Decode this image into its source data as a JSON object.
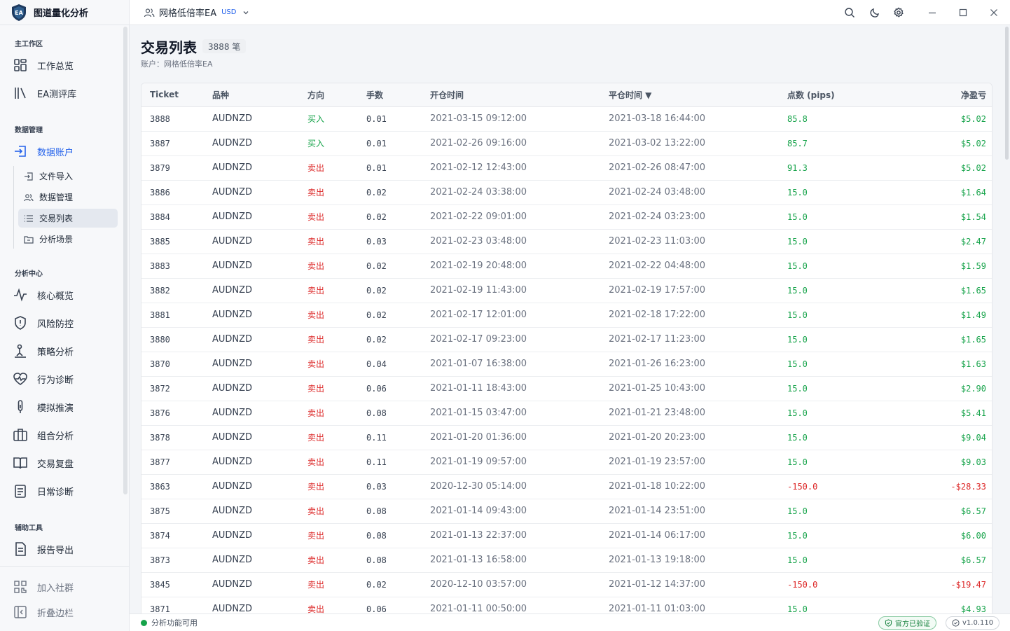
{
  "app": {
    "title": "图道量化分析",
    "logo_text": "EA"
  },
  "topbar": {
    "account_name": "网格低倍率EA",
    "currency": "USD"
  },
  "sidebar": {
    "sections": {
      "main": "主工作区",
      "data": "数据管理",
      "analysis": "分析中心",
      "tools": "辅助工具"
    },
    "main_items": [
      {
        "label": "工作总览"
      },
      {
        "label": "EA测评库"
      }
    ],
    "data_account": {
      "label": "数据账户"
    },
    "data_sub_items": [
      {
        "label": "文件导入"
      },
      {
        "label": "数据管理"
      },
      {
        "label": "交易列表"
      },
      {
        "label": "分析场景"
      }
    ],
    "analysis_items": [
      {
        "label": "核心概览"
      },
      {
        "label": "风险防控"
      },
      {
        "label": "策略分析"
      },
      {
        "label": "行为诊断"
      },
      {
        "label": "模拟推演"
      },
      {
        "label": "组合分析"
      },
      {
        "label": "交易复盘"
      },
      {
        "label": "日常诊断"
      }
    ],
    "tool_items": [
      {
        "label": "报告导出"
      }
    ],
    "bottom_items": [
      {
        "label": "加入社群"
      },
      {
        "label": "折叠边栏"
      }
    ]
  },
  "page": {
    "title": "交易列表",
    "count": "3888 笔",
    "subtitle": "账户：网格低倍率EA"
  },
  "table": {
    "columns": [
      "Ticket",
      "品种",
      "方向",
      "手数",
      "开仓时间",
      "平仓时间 ▼",
      "点数 (pips)",
      "净盈亏"
    ],
    "rows": [
      [
        "3888",
        "AUDNZD",
        "买入",
        "0.01",
        "2021-03-15 09:12:00",
        "2021-03-18 16:44:00",
        "85.8",
        "$5.02"
      ],
      [
        "3887",
        "AUDNZD",
        "买入",
        "0.01",
        "2021-02-26 09:16:00",
        "2021-03-02 13:22:00",
        "85.7",
        "$5.02"
      ],
      [
        "3879",
        "AUDNZD",
        "卖出",
        "0.01",
        "2021-02-12 12:43:00",
        "2021-02-26 08:47:00",
        "91.3",
        "$5.02"
      ],
      [
        "3886",
        "AUDNZD",
        "卖出",
        "0.02",
        "2021-02-24 03:38:00",
        "2021-02-24 03:48:00",
        "15.0",
        "$1.64"
      ],
      [
        "3884",
        "AUDNZD",
        "卖出",
        "0.02",
        "2021-02-22 09:01:00",
        "2021-02-24 03:23:00",
        "15.0",
        "$1.54"
      ],
      [
        "3885",
        "AUDNZD",
        "卖出",
        "0.03",
        "2021-02-23 03:48:00",
        "2021-02-23 11:03:00",
        "15.0",
        "$2.47"
      ],
      [
        "3883",
        "AUDNZD",
        "卖出",
        "0.02",
        "2021-02-19 20:48:00",
        "2021-02-22 04:48:00",
        "15.0",
        "$1.59"
      ],
      [
        "3882",
        "AUDNZD",
        "卖出",
        "0.02",
        "2021-02-19 11:43:00",
        "2021-02-19 17:57:00",
        "15.0",
        "$1.65"
      ],
      [
        "3881",
        "AUDNZD",
        "卖出",
        "0.02",
        "2021-02-17 12:01:00",
        "2021-02-18 17:22:00",
        "15.0",
        "$1.49"
      ],
      [
        "3880",
        "AUDNZD",
        "卖出",
        "0.02",
        "2021-02-17 09:23:00",
        "2021-02-17 11:23:00",
        "15.0",
        "$1.65"
      ],
      [
        "3870",
        "AUDNZD",
        "卖出",
        "0.04",
        "2021-01-07 16:38:00",
        "2021-01-26 16:23:00",
        "15.0",
        "$1.63"
      ],
      [
        "3872",
        "AUDNZD",
        "卖出",
        "0.06",
        "2021-01-11 18:43:00",
        "2021-01-25 10:43:00",
        "15.0",
        "$2.90"
      ],
      [
        "3876",
        "AUDNZD",
        "卖出",
        "0.08",
        "2021-01-15 03:47:00",
        "2021-01-21 23:48:00",
        "15.0",
        "$5.41"
      ],
      [
        "3878",
        "AUDNZD",
        "卖出",
        "0.11",
        "2021-01-20 01:36:00",
        "2021-01-20 20:23:00",
        "15.0",
        "$9.04"
      ],
      [
        "3877",
        "AUDNZD",
        "卖出",
        "0.11",
        "2021-01-19 09:57:00",
        "2021-01-19 23:57:00",
        "15.0",
        "$9.03"
      ],
      [
        "3863",
        "AUDNZD",
        "卖出",
        "0.03",
        "2020-12-30 05:14:00",
        "2021-01-18 10:22:00",
        "-150.0",
        "-$28.33"
      ],
      [
        "3875",
        "AUDNZD",
        "卖出",
        "0.08",
        "2021-01-14 09:43:00",
        "2021-01-14 23:51:00",
        "15.0",
        "$6.57"
      ],
      [
        "3874",
        "AUDNZD",
        "卖出",
        "0.08",
        "2021-01-13 22:37:00",
        "2021-01-14 06:17:00",
        "15.0",
        "$6.00"
      ],
      [
        "3873",
        "AUDNZD",
        "卖出",
        "0.08",
        "2021-01-13 16:58:00",
        "2021-01-13 19:18:00",
        "15.0",
        "$6.57"
      ],
      [
        "3845",
        "AUDNZD",
        "卖出",
        "0.02",
        "2020-12-10 03:57:00",
        "2021-01-12 14:37:00",
        "-150.0",
        "-$19.47"
      ],
      [
        "3871",
        "AUDNZD",
        "卖出",
        "0.06",
        "2021-01-11 00:50:00",
        "2021-01-11 01:03:00",
        "15.0",
        "$4.93"
      ]
    ]
  },
  "status": {
    "text": "分析功能可用",
    "verified": "官方已验证",
    "version": "v1.0.110"
  },
  "colors": {
    "accent": "#2563eb",
    "buy": "#16a34a",
    "sell": "#dc2626"
  }
}
